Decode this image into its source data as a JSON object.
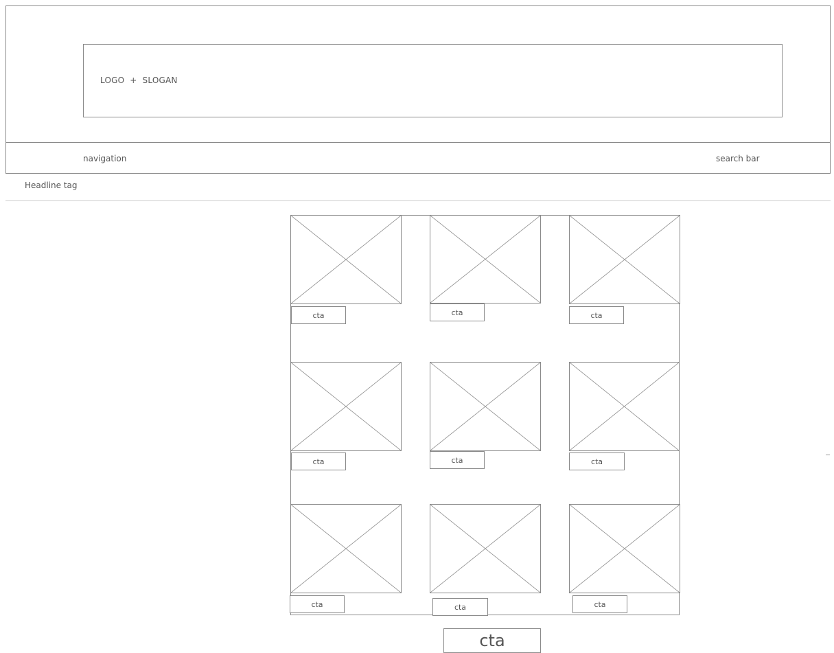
{
  "header": {
    "logo_slogan": "LOGO  +  SLOGAN"
  },
  "nav": {
    "navigation_label": "navigation",
    "search_label": "search bar"
  },
  "headline": "Headline tag",
  "grid": {
    "items": [
      {
        "cta": "cta"
      },
      {
        "cta": "cta"
      },
      {
        "cta": "cta"
      },
      {
        "cta": "cta"
      },
      {
        "cta": "cta"
      },
      {
        "cta": "cta"
      },
      {
        "cta": "cta"
      },
      {
        "cta": "cta"
      },
      {
        "cta": "cta"
      }
    ]
  },
  "main_cta": "cta"
}
